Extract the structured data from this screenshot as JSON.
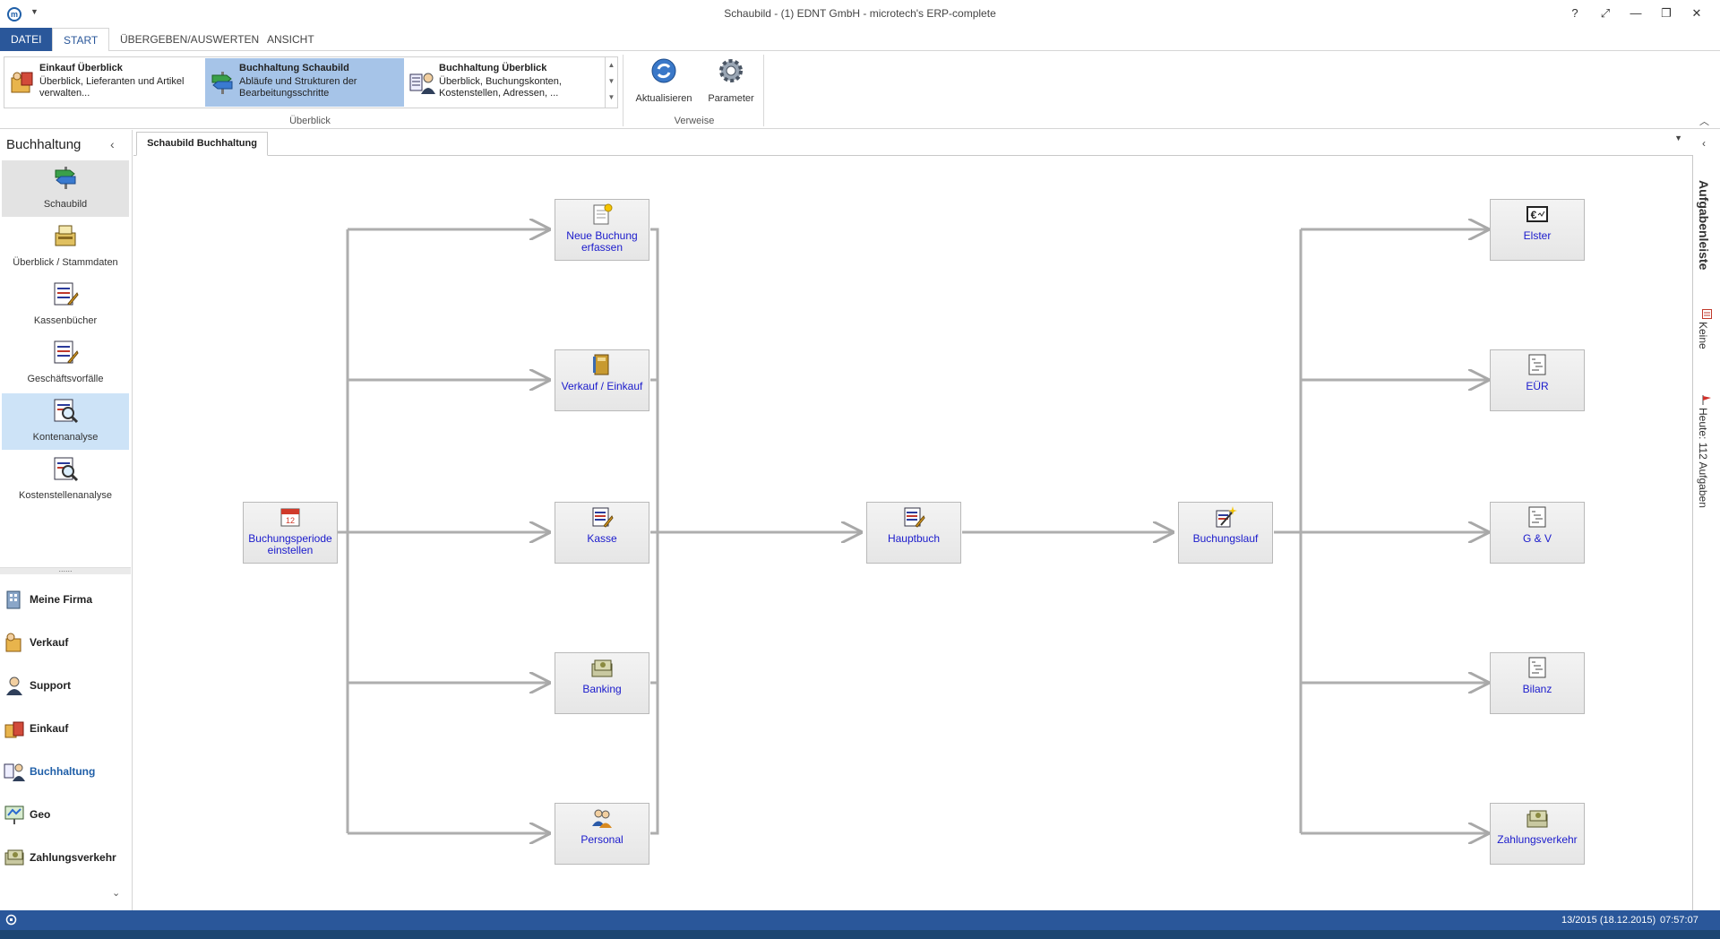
{
  "window": {
    "title": "Schaubild - (1) EDNT GmbH - microtech's ERP-complete",
    "help": "?",
    "controls": [
      "⤢",
      "—",
      "❐",
      "✕"
    ]
  },
  "ribbon": {
    "tabs": [
      "DATEI",
      "START",
      "ÜBERGEBEN/AUSWERTEN",
      "ANSICHT"
    ],
    "gallery": [
      {
        "title": "Einkauf Überblick",
        "desc": "Überblick, Lieferanten und Artikel verwalten..."
      },
      {
        "title": "Buchhaltung Schaubild",
        "desc": "Abläufe und Strukturen der Bearbeitungsschritte"
      },
      {
        "title": "Buchhaltung Überblick",
        "desc": "Überblick, Buchungskonten, Kostenstellen, Adressen, ..."
      }
    ],
    "group_ueberblick": "Überblick",
    "buttons": {
      "aktualisieren": "Aktualisieren",
      "parameter": "Parameter"
    },
    "group_verweise": "Verweise"
  },
  "nav": {
    "title": "Buchhaltung",
    "items": [
      "Schaubild",
      "Überblick / Stammdaten",
      "Kassenbücher",
      "Geschäftsvorfälle",
      "Kontenanalyse",
      "Kostenstellenanalyse"
    ],
    "splitter": "......",
    "modules": [
      "Meine Firma",
      "Verkauf",
      "Support",
      "Einkauf",
      "Buchhaltung",
      "Geo",
      "Zahlungsverkehr"
    ]
  },
  "document": {
    "tab": "Schaubild Buchhaltung"
  },
  "diagram": {
    "nodes": {
      "buchungsperiode": "Buchungsperiode einstellen",
      "neue_buchung": "Neue Buchung erfassen",
      "verkauf_einkauf": "Verkauf / Einkauf",
      "kasse": "Kasse",
      "banking": "Banking",
      "personal": "Personal",
      "hauptbuch": "Hauptbuch",
      "buchungslauf": "Buchungslauf",
      "elster": "Elster",
      "euer": "EÜR",
      "guv": "G & V",
      "bilanz": "Bilanz",
      "zahlungsverkehr": "Zahlungsverkehr"
    }
  },
  "taskpane": {
    "title": "Aufgabenleiste",
    "keine": "Keine",
    "heute": "Heute: 112 Aufgaben"
  },
  "status": {
    "period": "13/2015   (18.12.2015)",
    "time": "07:57:07"
  },
  "colors": {
    "accent": "#2a579a",
    "selection": "#a6c4e8",
    "link": "#1a1acc"
  }
}
